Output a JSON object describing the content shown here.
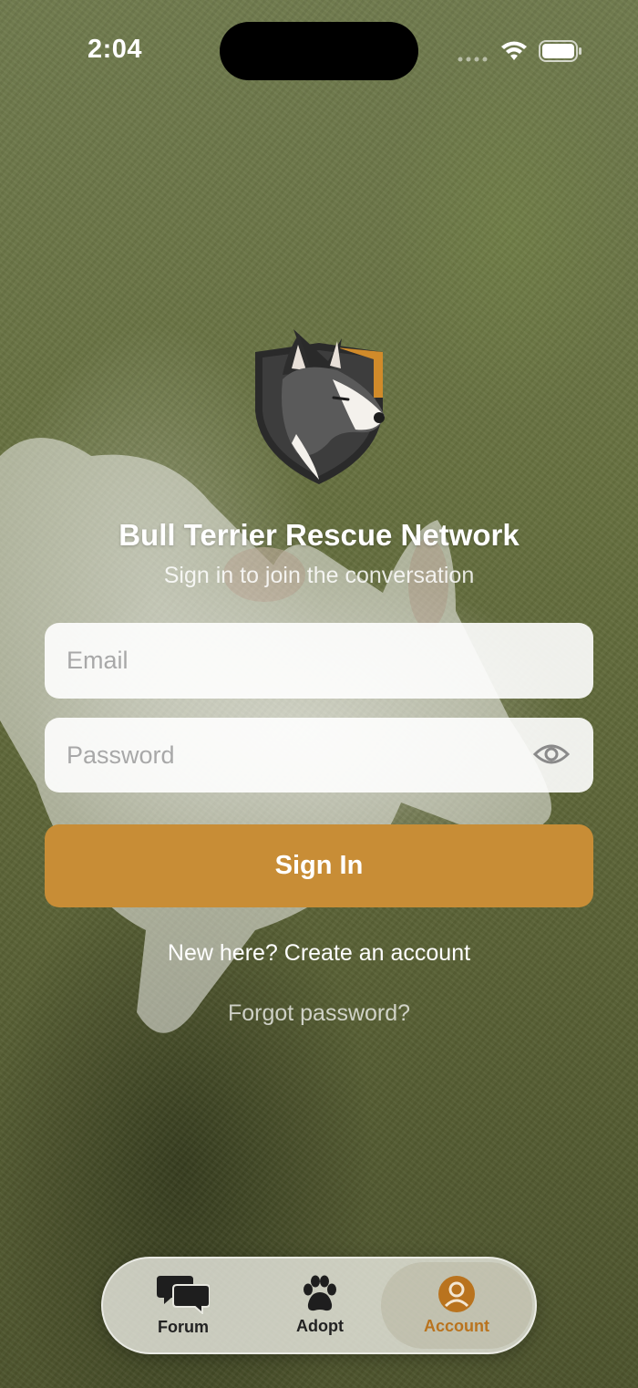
{
  "status_bar": {
    "time": "2:04"
  },
  "app": {
    "title": "Bull Terrier Rescue Network",
    "subtitle": "Sign in to join the conversation",
    "logo_icon": "bull-terrier-shield-logo"
  },
  "form": {
    "email_placeholder": "Email",
    "email_value": "",
    "password_placeholder": "Password",
    "password_value": "",
    "show_password_icon": "eye-icon",
    "signin_label": "Sign In",
    "create_account_label": "New here? Create an account",
    "forgot_password_label": "Forgot password?"
  },
  "tab_bar": {
    "tabs": [
      {
        "label": "Forum",
        "icon": "chat-bubbles-icon",
        "active": false
      },
      {
        "label": "Adopt",
        "icon": "paw-icon",
        "active": false
      },
      {
        "label": "Account",
        "icon": "account-circle-icon",
        "active": true
      }
    ]
  },
  "colors": {
    "accent": "#c88d36",
    "active_tab": "#b9731e",
    "text_light": "#ffffff"
  }
}
